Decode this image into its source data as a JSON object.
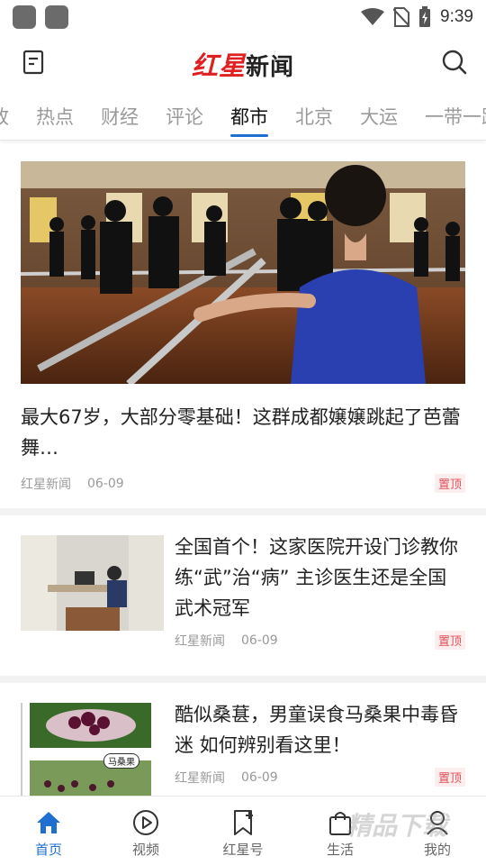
{
  "status_bar": {
    "time": "9:39"
  },
  "header": {
    "logo_red": "红星",
    "logo_black": "新闻"
  },
  "tabs": [
    {
      "label": "政"
    },
    {
      "label": "热点"
    },
    {
      "label": "财经"
    },
    {
      "label": "评论"
    },
    {
      "label": "都市",
      "active": true
    },
    {
      "label": "北京"
    },
    {
      "label": "大运"
    },
    {
      "label": "一带一路"
    }
  ],
  "feed": {
    "featured": {
      "title": "最大67岁，大部分零基础！这群成都嬢嬢跳起了芭蕾舞…",
      "source": "红星新闻",
      "date": "06-09",
      "badge": "置顶"
    },
    "items": [
      {
        "title": "全国首个！这家医院开设门诊教你练“武”治“病” 主诊医生还是全国武术冠军",
        "source": "红星新闻",
        "date": "06-09",
        "badge": "置顶"
      },
      {
        "title": "酷似桑葚，男童误食马桑果中毒昏迷 如何辨别看这里！",
        "source": "红星新闻",
        "date": "06-09",
        "badge": "置顶",
        "thumb_label": "马桑果"
      }
    ]
  },
  "bottom_nav": [
    {
      "label": "首页",
      "icon": "home-icon",
      "active": true
    },
    {
      "label": "视频",
      "icon": "play-icon"
    },
    {
      "label": "红星号",
      "icon": "bookmark-star-icon"
    },
    {
      "label": "生活",
      "icon": "shopping-bag-icon"
    },
    {
      "label": "我的",
      "icon": "user-icon"
    }
  ],
  "watermark": "精品下载",
  "colors": {
    "accent": "#1f6fd1",
    "brand_red": "#e02020",
    "badge_red": "#e0505a"
  }
}
